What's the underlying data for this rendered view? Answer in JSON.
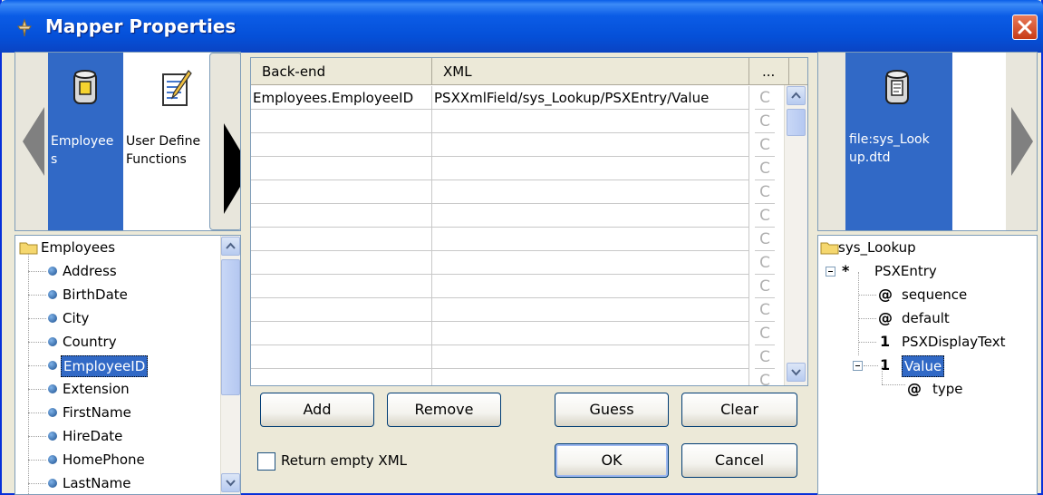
{
  "window": {
    "title": "Mapper Properties"
  },
  "left_palette": {
    "items": [
      {
        "label_lines": [
          "Employee",
          "s"
        ],
        "icon": "database-icon",
        "selected": true
      },
      {
        "label_lines": [
          "User Define",
          "Functions"
        ],
        "icon": "function-icon",
        "selected": false
      }
    ]
  },
  "left_tree": {
    "root": "Employees",
    "fields": [
      "Address",
      "BirthDate",
      "City",
      "Country",
      "EmployeeID",
      "Extension",
      "FirstName",
      "HireDate",
      "HomePhone",
      "LastName"
    ],
    "selected": "EmployeeID"
  },
  "grid": {
    "columns": [
      "Back-end",
      "XML",
      "..."
    ],
    "rows": [
      {
        "backend": "Employees.EmployeeID",
        "xml": "PSXXmlField/sys_Lookup/PSXEntry/Value",
        "flag": "C"
      },
      {
        "backend": "",
        "xml": "",
        "flag": "C"
      },
      {
        "backend": "",
        "xml": "",
        "flag": "C"
      },
      {
        "backend": "",
        "xml": "",
        "flag": "C"
      },
      {
        "backend": "",
        "xml": "",
        "flag": "C"
      },
      {
        "backend": "",
        "xml": "",
        "flag": "C"
      },
      {
        "backend": "",
        "xml": "",
        "flag": "C"
      },
      {
        "backend": "",
        "xml": "",
        "flag": "C"
      },
      {
        "backend": "",
        "xml": "",
        "flag": "C"
      },
      {
        "backend": "",
        "xml": "",
        "flag": "C"
      },
      {
        "backend": "",
        "xml": "",
        "flag": "C"
      },
      {
        "backend": "",
        "xml": "",
        "flag": "C"
      },
      {
        "backend": "",
        "xml": "",
        "flag": "C"
      }
    ]
  },
  "buttons": {
    "add": "Add",
    "remove": "Remove",
    "guess": "Guess",
    "clear": "Clear",
    "ok": "OK",
    "cancel": "Cancel"
  },
  "return_empty_xml": {
    "label": "Return empty XML",
    "checked": false
  },
  "right_palette": {
    "label_lines": [
      "file:sys_Look",
      "up.dtd"
    ],
    "icon": "dtd-file-icon"
  },
  "right_tree": {
    "root": "sys_Lookup",
    "entry": {
      "cardinality": "*",
      "label": "PSXEntry"
    },
    "children": [
      {
        "marker": "@",
        "label": "sequence"
      },
      {
        "marker": "@",
        "label": "default"
      },
      {
        "marker": "1",
        "label": "PSXDisplayText"
      },
      {
        "marker": "1",
        "label": "Value"
      }
    ],
    "value_children": [
      {
        "marker": "@",
        "label": "type"
      }
    ],
    "selected": "Value"
  }
}
